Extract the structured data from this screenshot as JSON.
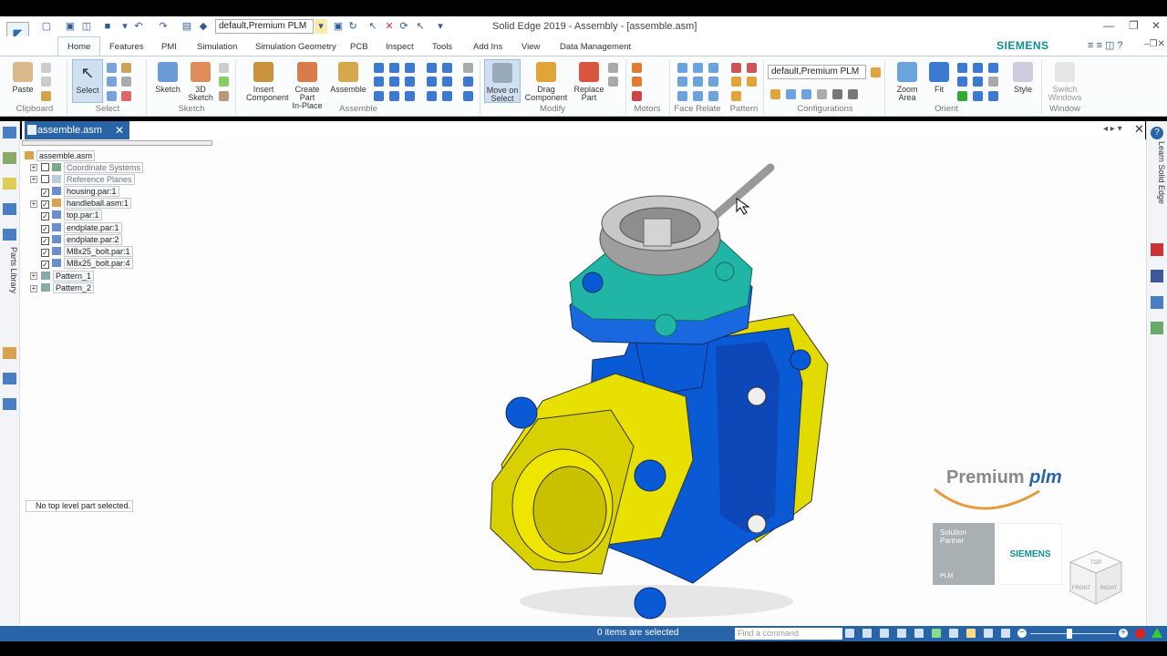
{
  "window": {
    "title": "Solid Edge 2019 - Assembly - [assemble.asm]",
    "config_combo": "default,Premium PLM"
  },
  "brand": "SIEMENS",
  "tabs": [
    "Home",
    "Features",
    "PMI",
    "Simulation",
    "Simulation Geometry",
    "PCB",
    "Inspect",
    "Tools",
    "Add Ins",
    "View",
    "Data Management"
  ],
  "ribbon": {
    "paste": "Paste",
    "select": "Select",
    "sketch": "Sketch",
    "sketch3d_1": "3D",
    "sketch3d_2": "Sketch",
    "insert_1": "Insert",
    "insert_2": "Component",
    "createpart_1": "Create Part",
    "createpart_2": "In-Place",
    "assemble": "Assemble",
    "move_1": "Move on",
    "move_2": "Select",
    "drag_1": "Drag",
    "drag_2": "Component",
    "replace_1": "Replace",
    "replace_2": "Part",
    "config_combo": "default,Premium PLM",
    "zoom_1": "Zoom",
    "zoom_2": "Area",
    "fit": "Fit",
    "style": "Style",
    "switch_1": "Switch",
    "switch_2": "Windows",
    "groups": {
      "clipboard": "Clipboard",
      "select": "Select",
      "sketch": "Sketch",
      "assemble": "Assemble",
      "modify": "Modify",
      "motors": "Motors",
      "face_relate": "Face Relate",
      "pattern": "Pattern",
      "configurations": "Configurations",
      "orient": "Orient",
      "window": "Window"
    }
  },
  "doc_tab": "assemble.asm",
  "left_panel": {
    "parts_library": "Parts Library"
  },
  "right_panel": {
    "learn": "Learn Solid Edge"
  },
  "tree": {
    "root": "assemble.asm",
    "items": [
      {
        "label": "Coordinate Systems",
        "checked": false,
        "dim": true
      },
      {
        "label": "Reference Planes",
        "checked": false,
        "dim": true
      },
      {
        "label": "housing.par:1",
        "checked": true
      },
      {
        "label": "handleball.asm:1",
        "checked": true
      },
      {
        "label": "top.par:1",
        "checked": true
      },
      {
        "label": "endplate.par:1",
        "checked": true
      },
      {
        "label": "endplate.par:2",
        "checked": true
      },
      {
        "label": "M8x25_bolt.par:1",
        "checked": true
      },
      {
        "label": "M8x25_bolt.par:4",
        "checked": true
      },
      {
        "label": "Pattern_1"
      },
      {
        "label": "Pattern_2"
      }
    ]
  },
  "status_message": "No top level part selected.",
  "statusbar": {
    "items_selected": "0 items are selected",
    "find_placeholder": "Find a command"
  },
  "watermark": {
    "premium": "Premium",
    "plm": "plm",
    "solution": "Solution",
    "partner": "Partner",
    "plm_small": "PLM",
    "siemens": "SIEMENS"
  },
  "navcube": {
    "top": "TOP",
    "front": "FRONT",
    "right": "RIGHT"
  },
  "colors": {
    "accent": "#2a64a8",
    "siemens": "#0f8f99",
    "body_blue": "#0a5ad6",
    "flange_yellow": "#e8e000",
    "top_teal": "#21b5a6",
    "handle_gray": "#a6a6a6",
    "premium_orange": "#e89a3c"
  }
}
